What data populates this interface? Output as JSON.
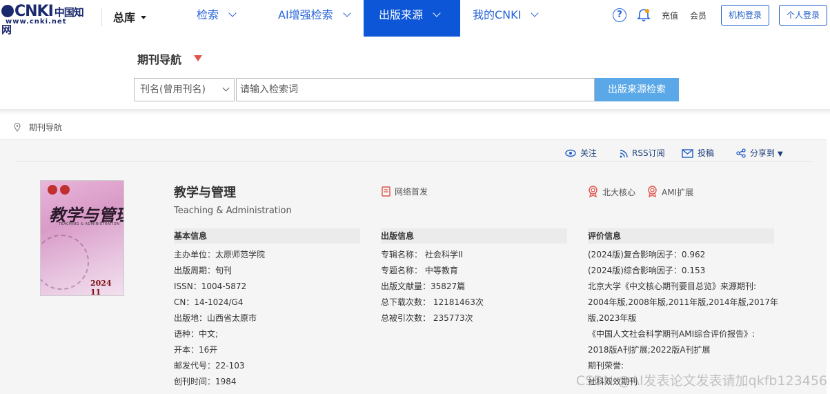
{
  "header": {
    "logo_text": "CNKI",
    "logo_cn": "中国知网",
    "logo_url": "www.cnki.net",
    "library": "总库",
    "nav": [
      {
        "label": "检索"
      },
      {
        "label": "AI增强检索"
      },
      {
        "label": "出版来源"
      },
      {
        "label": "我的CNKI"
      }
    ],
    "help_label": "?",
    "recharge": "充值",
    "member": "会员",
    "org_login": "机构登录",
    "personal_login": "个人登录"
  },
  "search": {
    "nav_title": "期刊导航",
    "field_select": "刊名(曾用刊名)",
    "placeholder": "请输入检索词",
    "button": "出版来源检索"
  },
  "breadcrumb": "期刊导航",
  "actions": {
    "follow": "关注",
    "rss": "RSS订阅",
    "submit": "投稿",
    "share": "分享到"
  },
  "journal": {
    "title": "教学与管理",
    "title_en": "Teaching & Administration",
    "cover_title": "教学与管理",
    "cover_sub": "TEACHING & ADMINISTRATION",
    "cover_year": "2024 11",
    "tag_network": "网络首发",
    "tag_pku": "北大核心",
    "tag_ami": "AMI扩展"
  },
  "basic": {
    "heading": "基本信息",
    "rows": [
      "主办单位：太原师范学院",
      "出版周期：旬刊",
      "ISSN：1004-5872",
      "CN：14-1024/G4",
      "出版地：山西省太原市",
      "语种：中文;",
      "开本：16开",
      "邮发代号：22-103",
      "创刊时间：1984"
    ]
  },
  "publish": {
    "heading": "出版信息",
    "rows": [
      "专辑名称：  社会科学II",
      "专题名称：  中等教育",
      "出版文献量：35827篇",
      "总下载次数：  12181463次",
      "总被引次数：  235773次"
    ]
  },
  "evaluation": {
    "heading": "评价信息",
    "rows": [
      "(2024版)复合影响因子：0.962",
      "(2024版)综合影响因子：0.153",
      "北京大学《中文核心期刊要目总览》来源期刊:",
      "2004年版,2008年版,2011年版,2014年版,2017年",
      "版,2023年版",
      "《中国人文社会科学期刊AMI综合评价报告》:",
      "2018版A刊扩展;2022版A刊扩展",
      "期刊荣誉:",
      "社科双效期刊"
    ]
  },
  "watermark": "CSDN @AI发表论文发表请加qkfb123456",
  "colors": {
    "brand_blue": "#0d56d8",
    "link_blue": "#2764d8",
    "search_button": "#5aa8e8",
    "badge_red": "#e0534a"
  }
}
